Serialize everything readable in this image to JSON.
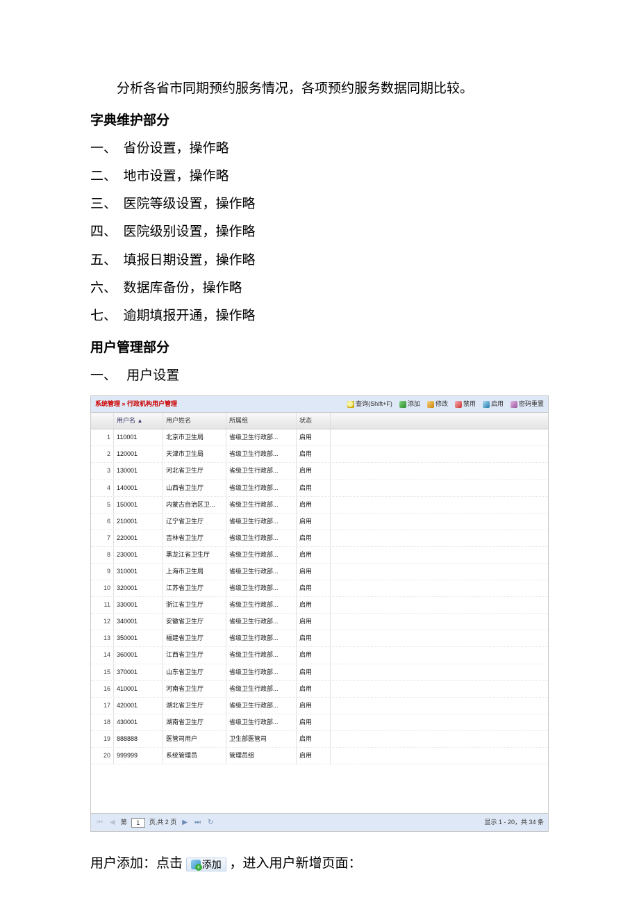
{
  "text": {
    "intro": "分析各省市同期预约服务情况，各项预约服务数据同期比较。",
    "section_dict": "字典维护部分",
    "dict_items": [
      {
        "num": "一、",
        "text": "省份设置，操作略"
      },
      {
        "num": "二、",
        "text": "地市设置，操作略"
      },
      {
        "num": "三、",
        "text": "医院等级设置，操作略"
      },
      {
        "num": "四、",
        "text": "医院级别设置，操作略"
      },
      {
        "num": "五、",
        "text": "填报日期设置，操作略"
      },
      {
        "num": "六、",
        "text": "数据库备份，操作略"
      },
      {
        "num": "七、",
        "text": "逾期填报开通，操作略"
      }
    ],
    "section_user": "用户管理部分",
    "user_item_num": "一、",
    "user_item_text": "用户设置",
    "footer_prefix": "用户添加：点击",
    "footer_btn": "添加",
    "footer_suffix": "，进入用户新增页面："
  },
  "panel": {
    "breadcrumb": "系统管理 » 行政机构用户管理",
    "buttons": {
      "search": "查询(Shift+F)",
      "add": "添加",
      "edit": "修改",
      "disable": "禁用",
      "enable": "启用",
      "reset": "密码重置"
    },
    "columns": {
      "user": "用户名",
      "realname": "用户姓名",
      "group": "所属组",
      "status": "状态"
    },
    "rows": [
      {
        "i": "1",
        "user": "110001",
        "name": "北京市卫生局",
        "group": "省级卫生行政部...",
        "status": "启用"
      },
      {
        "i": "2",
        "user": "120001",
        "name": "天津市卫生局",
        "group": "省级卫生行政部...",
        "status": "启用"
      },
      {
        "i": "3",
        "user": "130001",
        "name": "河北省卫生厅",
        "group": "省级卫生行政部...",
        "status": "启用"
      },
      {
        "i": "4",
        "user": "140001",
        "name": "山西省卫生厅",
        "group": "省级卫生行政部...",
        "status": "启用"
      },
      {
        "i": "5",
        "user": "150001",
        "name": "内蒙古自治区卫...",
        "group": "省级卫生行政部...",
        "status": "启用"
      },
      {
        "i": "6",
        "user": "210001",
        "name": "辽宁省卫生厅",
        "group": "省级卫生行政部...",
        "status": "启用"
      },
      {
        "i": "7",
        "user": "220001",
        "name": "吉林省卫生厅",
        "group": "省级卫生行政部...",
        "status": "启用"
      },
      {
        "i": "8",
        "user": "230001",
        "name": "黑龙江省卫生厅",
        "group": "省级卫生行政部...",
        "status": "启用"
      },
      {
        "i": "9",
        "user": "310001",
        "name": "上海市卫生局",
        "group": "省级卫生行政部...",
        "status": "启用"
      },
      {
        "i": "10",
        "user": "320001",
        "name": "江苏省卫生厅",
        "group": "省级卫生行政部...",
        "status": "启用"
      },
      {
        "i": "11",
        "user": "330001",
        "name": "浙江省卫生厅",
        "group": "省级卫生行政部...",
        "status": "启用"
      },
      {
        "i": "12",
        "user": "340001",
        "name": "安徽省卫生厅",
        "group": "省级卫生行政部...",
        "status": "启用"
      },
      {
        "i": "13",
        "user": "350001",
        "name": "福建省卫生厅",
        "group": "省级卫生行政部...",
        "status": "启用"
      },
      {
        "i": "14",
        "user": "360001",
        "name": "江西省卫生厅",
        "group": "省级卫生行政部...",
        "status": "启用"
      },
      {
        "i": "15",
        "user": "370001",
        "name": "山东省卫生厅",
        "group": "省级卫生行政部...",
        "status": "启用"
      },
      {
        "i": "16",
        "user": "410001",
        "name": "河南省卫生厅",
        "group": "省级卫生行政部...",
        "status": "启用"
      },
      {
        "i": "17",
        "user": "420001",
        "name": "湖北省卫生厅",
        "group": "省级卫生行政部...",
        "status": "启用"
      },
      {
        "i": "18",
        "user": "430001",
        "name": "湖南省卫生厅",
        "group": "省级卫生行政部...",
        "status": "启用"
      },
      {
        "i": "19",
        "user": "888888",
        "name": "医管司用户",
        "group": "卫生部医管司",
        "status": "启用"
      },
      {
        "i": "20",
        "user": "999999",
        "name": "系统管理员",
        "group": "管理员组",
        "status": "启用"
      }
    ],
    "pager": {
      "page_label_prefix": "第",
      "page_value": "1",
      "page_label_suffix": "页,共 2 页",
      "summary": "显示 1 - 20，共 34 条"
    }
  }
}
